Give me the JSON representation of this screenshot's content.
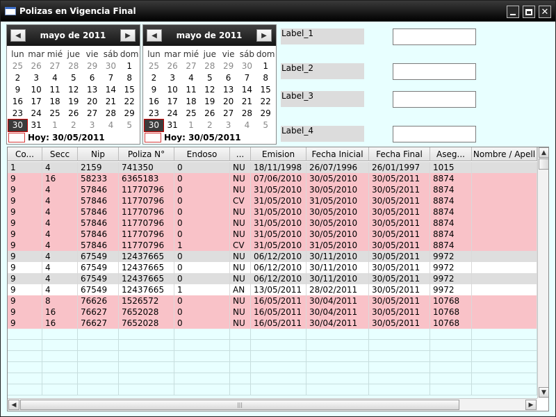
{
  "window": {
    "title": "Polizas en Vigencia Final",
    "icon": "window-icon"
  },
  "calendar_left": {
    "month_label": "mayo de 2011",
    "weekdays": [
      "lun",
      "mar",
      "mié",
      "jue",
      "vie",
      "sáb",
      "dom"
    ],
    "weeks": [
      [
        [
          "25",
          1
        ],
        [
          "26",
          1
        ],
        [
          "27",
          1
        ],
        [
          "28",
          1
        ],
        [
          "29",
          1
        ],
        [
          "30",
          1
        ],
        [
          "1",
          0
        ]
      ],
      [
        [
          "2",
          0
        ],
        [
          "3",
          0
        ],
        [
          "4",
          0
        ],
        [
          "5",
          0
        ],
        [
          "6",
          0
        ],
        [
          "7",
          0
        ],
        [
          "8",
          0
        ]
      ],
      [
        [
          "9",
          0
        ],
        [
          "10",
          0
        ],
        [
          "11",
          0
        ],
        [
          "12",
          0
        ],
        [
          "13",
          0
        ],
        [
          "14",
          0
        ],
        [
          "15",
          0
        ]
      ],
      [
        [
          "16",
          0
        ],
        [
          "17",
          0
        ],
        [
          "18",
          0
        ],
        [
          "19",
          0
        ],
        [
          "20",
          0
        ],
        [
          "21",
          0
        ],
        [
          "22",
          0
        ]
      ],
      [
        [
          "23",
          0
        ],
        [
          "24",
          0
        ],
        [
          "25",
          0
        ],
        [
          "26",
          0
        ],
        [
          "27",
          0
        ],
        [
          "28",
          0
        ],
        [
          "29",
          0
        ]
      ],
      [
        [
          "30",
          2
        ],
        [
          "31",
          0
        ],
        [
          "1",
          1
        ],
        [
          "2",
          1
        ],
        [
          "3",
          1
        ],
        [
          "4",
          1
        ],
        [
          "5",
          1
        ]
      ]
    ],
    "today_label": "Hoy: 30/05/2011"
  },
  "calendar_right": {
    "month_label": "mayo de 2011",
    "weekdays": [
      "lun",
      "mar",
      "mié",
      "jue",
      "vie",
      "sáb",
      "dom"
    ],
    "weeks": [
      [
        [
          "25",
          1
        ],
        [
          "26",
          1
        ],
        [
          "27",
          1
        ],
        [
          "28",
          1
        ],
        [
          "29",
          1
        ],
        [
          "30",
          1
        ],
        [
          "1",
          0
        ]
      ],
      [
        [
          "2",
          0
        ],
        [
          "3",
          0
        ],
        [
          "4",
          0
        ],
        [
          "5",
          0
        ],
        [
          "6",
          0
        ],
        [
          "7",
          0
        ],
        [
          "8",
          0
        ]
      ],
      [
        [
          "9",
          0
        ],
        [
          "10",
          0
        ],
        [
          "11",
          0
        ],
        [
          "12",
          0
        ],
        [
          "13",
          0
        ],
        [
          "14",
          0
        ],
        [
          "15",
          0
        ]
      ],
      [
        [
          "16",
          0
        ],
        [
          "17",
          0
        ],
        [
          "18",
          0
        ],
        [
          "19",
          0
        ],
        [
          "20",
          0
        ],
        [
          "21",
          0
        ],
        [
          "22",
          0
        ]
      ],
      [
        [
          "23",
          0
        ],
        [
          "24",
          0
        ],
        [
          "25",
          0
        ],
        [
          "26",
          0
        ],
        [
          "27",
          0
        ],
        [
          "28",
          0
        ],
        [
          "29",
          0
        ]
      ],
      [
        [
          "30",
          2
        ],
        [
          "31",
          0
        ],
        [
          "1",
          1
        ],
        [
          "2",
          1
        ],
        [
          "3",
          1
        ],
        [
          "4",
          1
        ],
        [
          "5",
          1
        ]
      ]
    ],
    "today_label": "Hoy: 30/05/2011"
  },
  "fields": [
    {
      "label": "Label_1",
      "value": ""
    },
    {
      "label": "Label_2",
      "value": ""
    },
    {
      "label": "Label_3",
      "value": ""
    },
    {
      "label": "Label_4",
      "value": ""
    }
  ],
  "table": {
    "columns": [
      "Co...",
      "Secc",
      "Nip",
      "Poliza N°",
      "Endoso",
      "...",
      "Emision",
      "Fecha Inicial",
      "Fecha Final",
      "Aseg...",
      "Nombre / Apell"
    ],
    "rows": [
      {
        "style": "gray",
        "cells": [
          "1",
          "4",
          "2159",
          "741350",
          "0",
          "NU",
          "18/11/1998",
          "26/07/1996",
          "26/01/1997",
          "1015",
          ""
        ]
      },
      {
        "style": "pink",
        "cells": [
          "9",
          "16",
          "58233",
          "6365183",
          "0",
          "NU",
          "07/06/2010",
          "30/05/2010",
          "30/05/2011",
          "8874",
          ""
        ]
      },
      {
        "style": "pink",
        "cells": [
          "9",
          "4",
          "57846",
          "11770796",
          "0",
          "NU",
          "31/05/2010",
          "30/05/2010",
          "30/05/2011",
          "8874",
          ""
        ]
      },
      {
        "style": "pink",
        "cells": [
          "9",
          "4",
          "57846",
          "11770796",
          "0",
          "CV",
          "31/05/2010",
          "31/05/2010",
          "30/05/2011",
          "8874",
          ""
        ]
      },
      {
        "style": "pink",
        "cells": [
          "9",
          "4",
          "57846",
          "11770796",
          "0",
          "NU",
          "31/05/2010",
          "30/05/2010",
          "30/05/2011",
          "8874",
          ""
        ]
      },
      {
        "style": "pink",
        "cells": [
          "9",
          "4",
          "57846",
          "11770796",
          "0",
          "NU",
          "31/05/2010",
          "30/05/2010",
          "30/05/2011",
          "8874",
          ""
        ]
      },
      {
        "style": "pink",
        "cells": [
          "9",
          "4",
          "57846",
          "11770796",
          "0",
          "NU",
          "31/05/2010",
          "30/05/2010",
          "30/05/2011",
          "8874",
          ""
        ]
      },
      {
        "style": "pink",
        "cells": [
          "9",
          "4",
          "57846",
          "11770796",
          "1",
          "CV",
          "31/05/2010",
          "31/05/2010",
          "30/05/2011",
          "8874",
          ""
        ]
      },
      {
        "style": "gray",
        "cells": [
          "9",
          "4",
          "67549",
          "12437665",
          "0",
          "NU",
          "06/12/2010",
          "30/11/2010",
          "30/05/2011",
          "9972",
          ""
        ]
      },
      {
        "style": "white",
        "cells": [
          "9",
          "4",
          "67549",
          "12437665",
          "0",
          "NU",
          "06/12/2010",
          "30/11/2010",
          "30/05/2011",
          "9972",
          ""
        ]
      },
      {
        "style": "gray",
        "cells": [
          "9",
          "4",
          "67549",
          "12437665",
          "0",
          "NU",
          "06/12/2010",
          "30/11/2010",
          "30/05/2011",
          "9972",
          ""
        ]
      },
      {
        "style": "white",
        "cells": [
          "9",
          "4",
          "67549",
          "12437665",
          "1",
          "AN",
          "13/05/2011",
          "28/02/2011",
          "30/05/2011",
          "9972",
          ""
        ]
      },
      {
        "style": "pink",
        "cells": [
          "9",
          "8",
          "76626",
          "1526572",
          "0",
          "NU",
          "16/05/2011",
          "30/04/2011",
          "30/05/2011",
          "10768",
          ""
        ]
      },
      {
        "style": "pink",
        "cells": [
          "9",
          "16",
          "76627",
          "7652028",
          "0",
          "NU",
          "16/05/2011",
          "30/04/2011",
          "30/05/2011",
          "10768",
          ""
        ]
      },
      {
        "style": "pink",
        "cells": [
          "9",
          "16",
          "76627",
          "7652028",
          "0",
          "NU",
          "16/05/2011",
          "30/04/2011",
          "30/05/2011",
          "10768",
          ""
        ]
      }
    ],
    "empty_rows": 6
  },
  "colors": {
    "pink_row": "#f9c2c8",
    "gray_row": "#dedede",
    "background": "#e8ffff"
  },
  "icons": {
    "prev": "chevron-left-icon",
    "next": "chevron-right-icon",
    "minimize": "minimize-icon",
    "maximize": "maximize-icon",
    "close": "close-icon"
  }
}
